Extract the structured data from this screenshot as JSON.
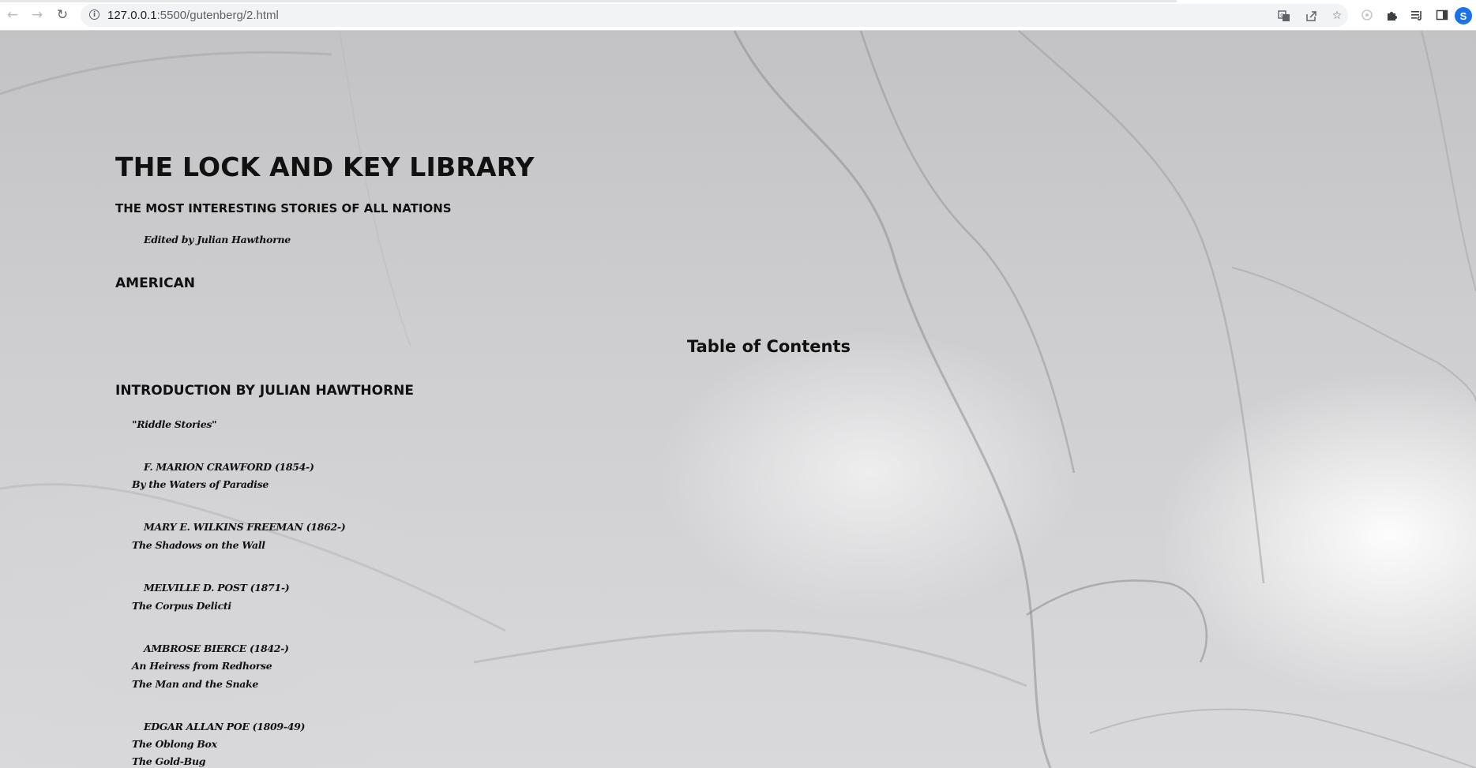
{
  "browser": {
    "url_host": "127.0.0.1",
    "url_rest": ":5500/gutenberg/2.html",
    "profile_initial": "S"
  },
  "page": {
    "title": "THE LOCK AND KEY LIBRARY",
    "subtitle": "THE MOST INTERESTING STORIES OF ALL NATIONS",
    "editor": "Edited by Julian Hawthorne",
    "region": "AMERICAN",
    "toc_heading": "Table of Contents",
    "intro_heading": "INTRODUCTION BY JULIAN HAWTHORNE",
    "intro_item": "\"Riddle Stories\"",
    "authors": [
      {
        "name": "F. MARION CRAWFORD (1854-)",
        "stories": [
          "By the Waters of Paradise"
        ]
      },
      {
        "name": "MARY E. WILKINS FREEMAN (1862-)",
        "stories": [
          "The Shadows on the Wall"
        ]
      },
      {
        "name": "MELVILLE D. POST (1871-)",
        "stories": [
          "The Corpus Delicti"
        ]
      },
      {
        "name": "AMBROSE BIERCE (1842-)",
        "stories": [
          "An Heiress from Redhorse",
          "The Man and the Snake"
        ]
      },
      {
        "name": "EDGAR ALLAN POE (1809-49)",
        "stories": [
          "The Oblong Box",
          "The Gold-Bug"
        ]
      }
    ]
  }
}
